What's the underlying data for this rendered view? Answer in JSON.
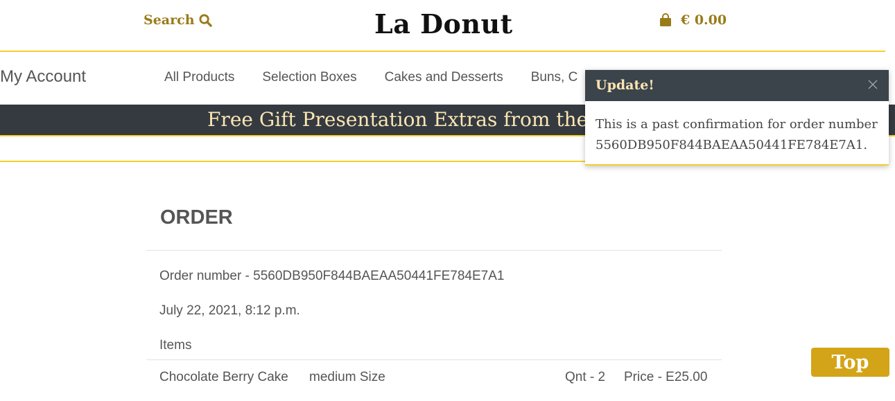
{
  "header": {
    "search_label": "Search",
    "brand": "La Donut",
    "cart_total": "€ 0.00"
  },
  "nav": {
    "my_account": "My Account",
    "items": [
      "All Products",
      "Selection Boxes",
      "Cakes and Desserts",
      "Buns, C"
    ]
  },
  "banner": {
    "text": "Free Gift Presentation Extras from the C"
  },
  "order": {
    "title": "ORDER",
    "number_line": "Order number - 5560DB950F844BAEAA50441FE784E7A1",
    "date": "July 22, 2021, 8:12 p.m.",
    "items_label": "Items",
    "items": [
      {
        "name": "Chocolate Berry Cake",
        "size": "medium Size",
        "qty": "Qnt - 2",
        "price": "Price - E25.00"
      }
    ]
  },
  "toast": {
    "title": "Update!",
    "message": "This is a past confirmation for order number 5560DB950F844BAEAA50441FE784E7A1."
  },
  "top_button": "Top",
  "colors": {
    "accent_gold": "#9a7b1a",
    "rule_yellow": "#f5cf2a",
    "dark_banner": "#343a40",
    "banner_text": "#fce6b4",
    "top_button": "#d4a418"
  },
  "icons": {
    "search": "search-icon",
    "cart": "shopping-bag-icon",
    "close": "close-icon"
  }
}
